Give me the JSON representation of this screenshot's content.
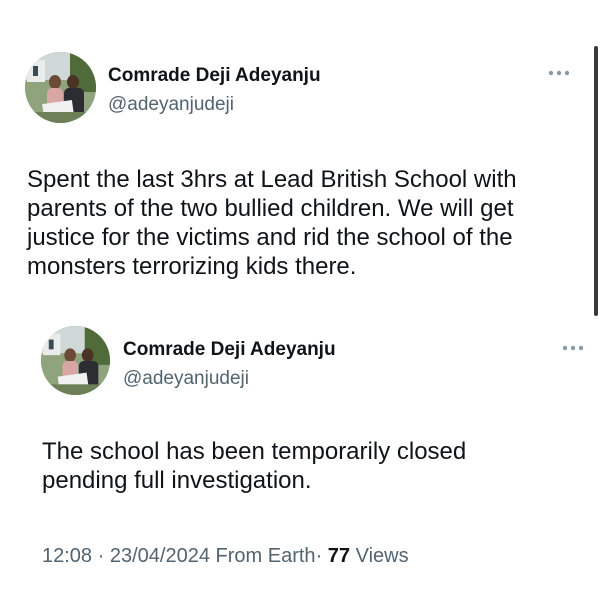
{
  "outer_tweet": {
    "display_name": "Comrade Deji Adeyanju",
    "handle": "@adeyanjudeji",
    "text": "Spent the last 3hrs at Lead British School with parents of the two bullied children. We will get justice for the victims and rid the school of the monsters terrorizing kids there."
  },
  "quoted_tweet": {
    "display_name": "Comrade Deji Adeyanju",
    "handle": "@adeyanjudeji",
    "text": "The school has been temporarily closed pending full investigation."
  },
  "meta": {
    "time": "12:08",
    "separator": "·",
    "date": "23/04/2024",
    "source": "From Earth",
    "views_count": "77",
    "views_label": "Views"
  },
  "icons": {
    "more": "more-horizontal-icon",
    "avatar": "profile-photo"
  }
}
